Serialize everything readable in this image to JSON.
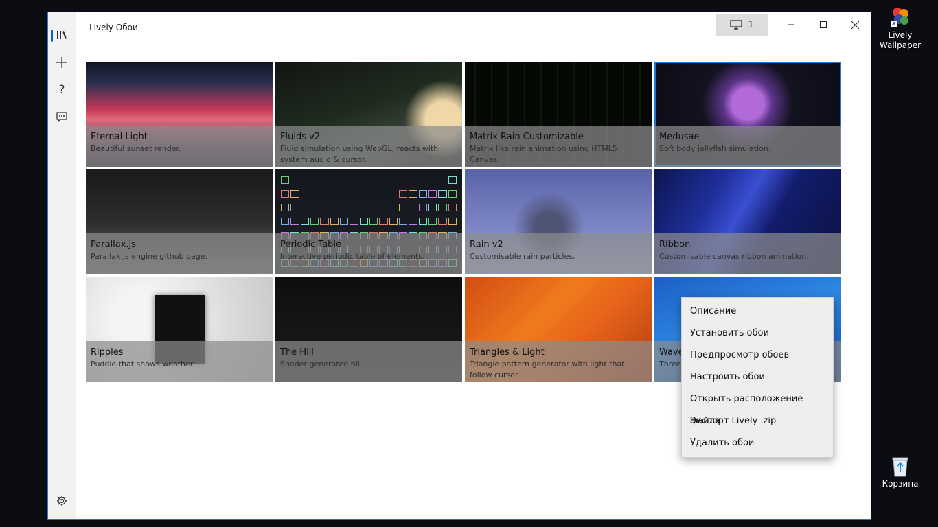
{
  "window": {
    "title": "Lively Обои",
    "monitor_count": "1",
    "border_color": "#2b6fd6"
  },
  "nav": {
    "items": [
      {
        "icon": "library-icon",
        "label": "Library"
      },
      {
        "icon": "plus-icon",
        "label": "Add"
      },
      {
        "icon": "help-icon",
        "label": "Help"
      },
      {
        "icon": "feedback-icon",
        "label": "Feedback"
      },
      {
        "icon": "gear-icon",
        "label": "Settings"
      }
    ]
  },
  "wallpapers": [
    {
      "title": "Eternal Light",
      "desc": "Beautiful sunset render."
    },
    {
      "title": "Fluids v2",
      "desc": "Fluid simulation using WebGL, reacts with system audio & cursor."
    },
    {
      "title": "Matrix Rain Customizable",
      "desc": "Matrix like rain animation using HTML5 Canvas."
    },
    {
      "title": "Medusae",
      "desc": "Soft body jellyfish simulation."
    },
    {
      "title": "Parallax.js",
      "desc": "Parallax.js engine github page."
    },
    {
      "title": "Periodic Table",
      "desc": "Interactive periodic table of elements."
    },
    {
      "title": "Rain v2",
      "desc": "Customisable rain particles."
    },
    {
      "title": "Ribbon",
      "desc": "Customisable canvas ribbon animation."
    },
    {
      "title": "Ripples",
      "desc": "Puddle that shows weather."
    },
    {
      "title": "The Hill",
      "desc": "Shader generated hill."
    },
    {
      "title": "Triangles & Light",
      "desc": "Triangle pattern generator with light that follow cursor."
    },
    {
      "title": "Wave",
      "desc": "Three."
    }
  ],
  "context_menu": {
    "items": [
      "Описание",
      "Установить обои",
      "Предпросмотр обоев",
      "Настроить обои",
      "Открыть расположение файла",
      "Экспорт Lively .zip",
      "Удалить обои"
    ]
  },
  "desktop": {
    "icons": [
      {
        "label": "Lively Wallpaper",
        "icon": "lively-app-icon"
      },
      {
        "label": "Корзина",
        "icon": "recycle-bin-icon"
      }
    ]
  }
}
